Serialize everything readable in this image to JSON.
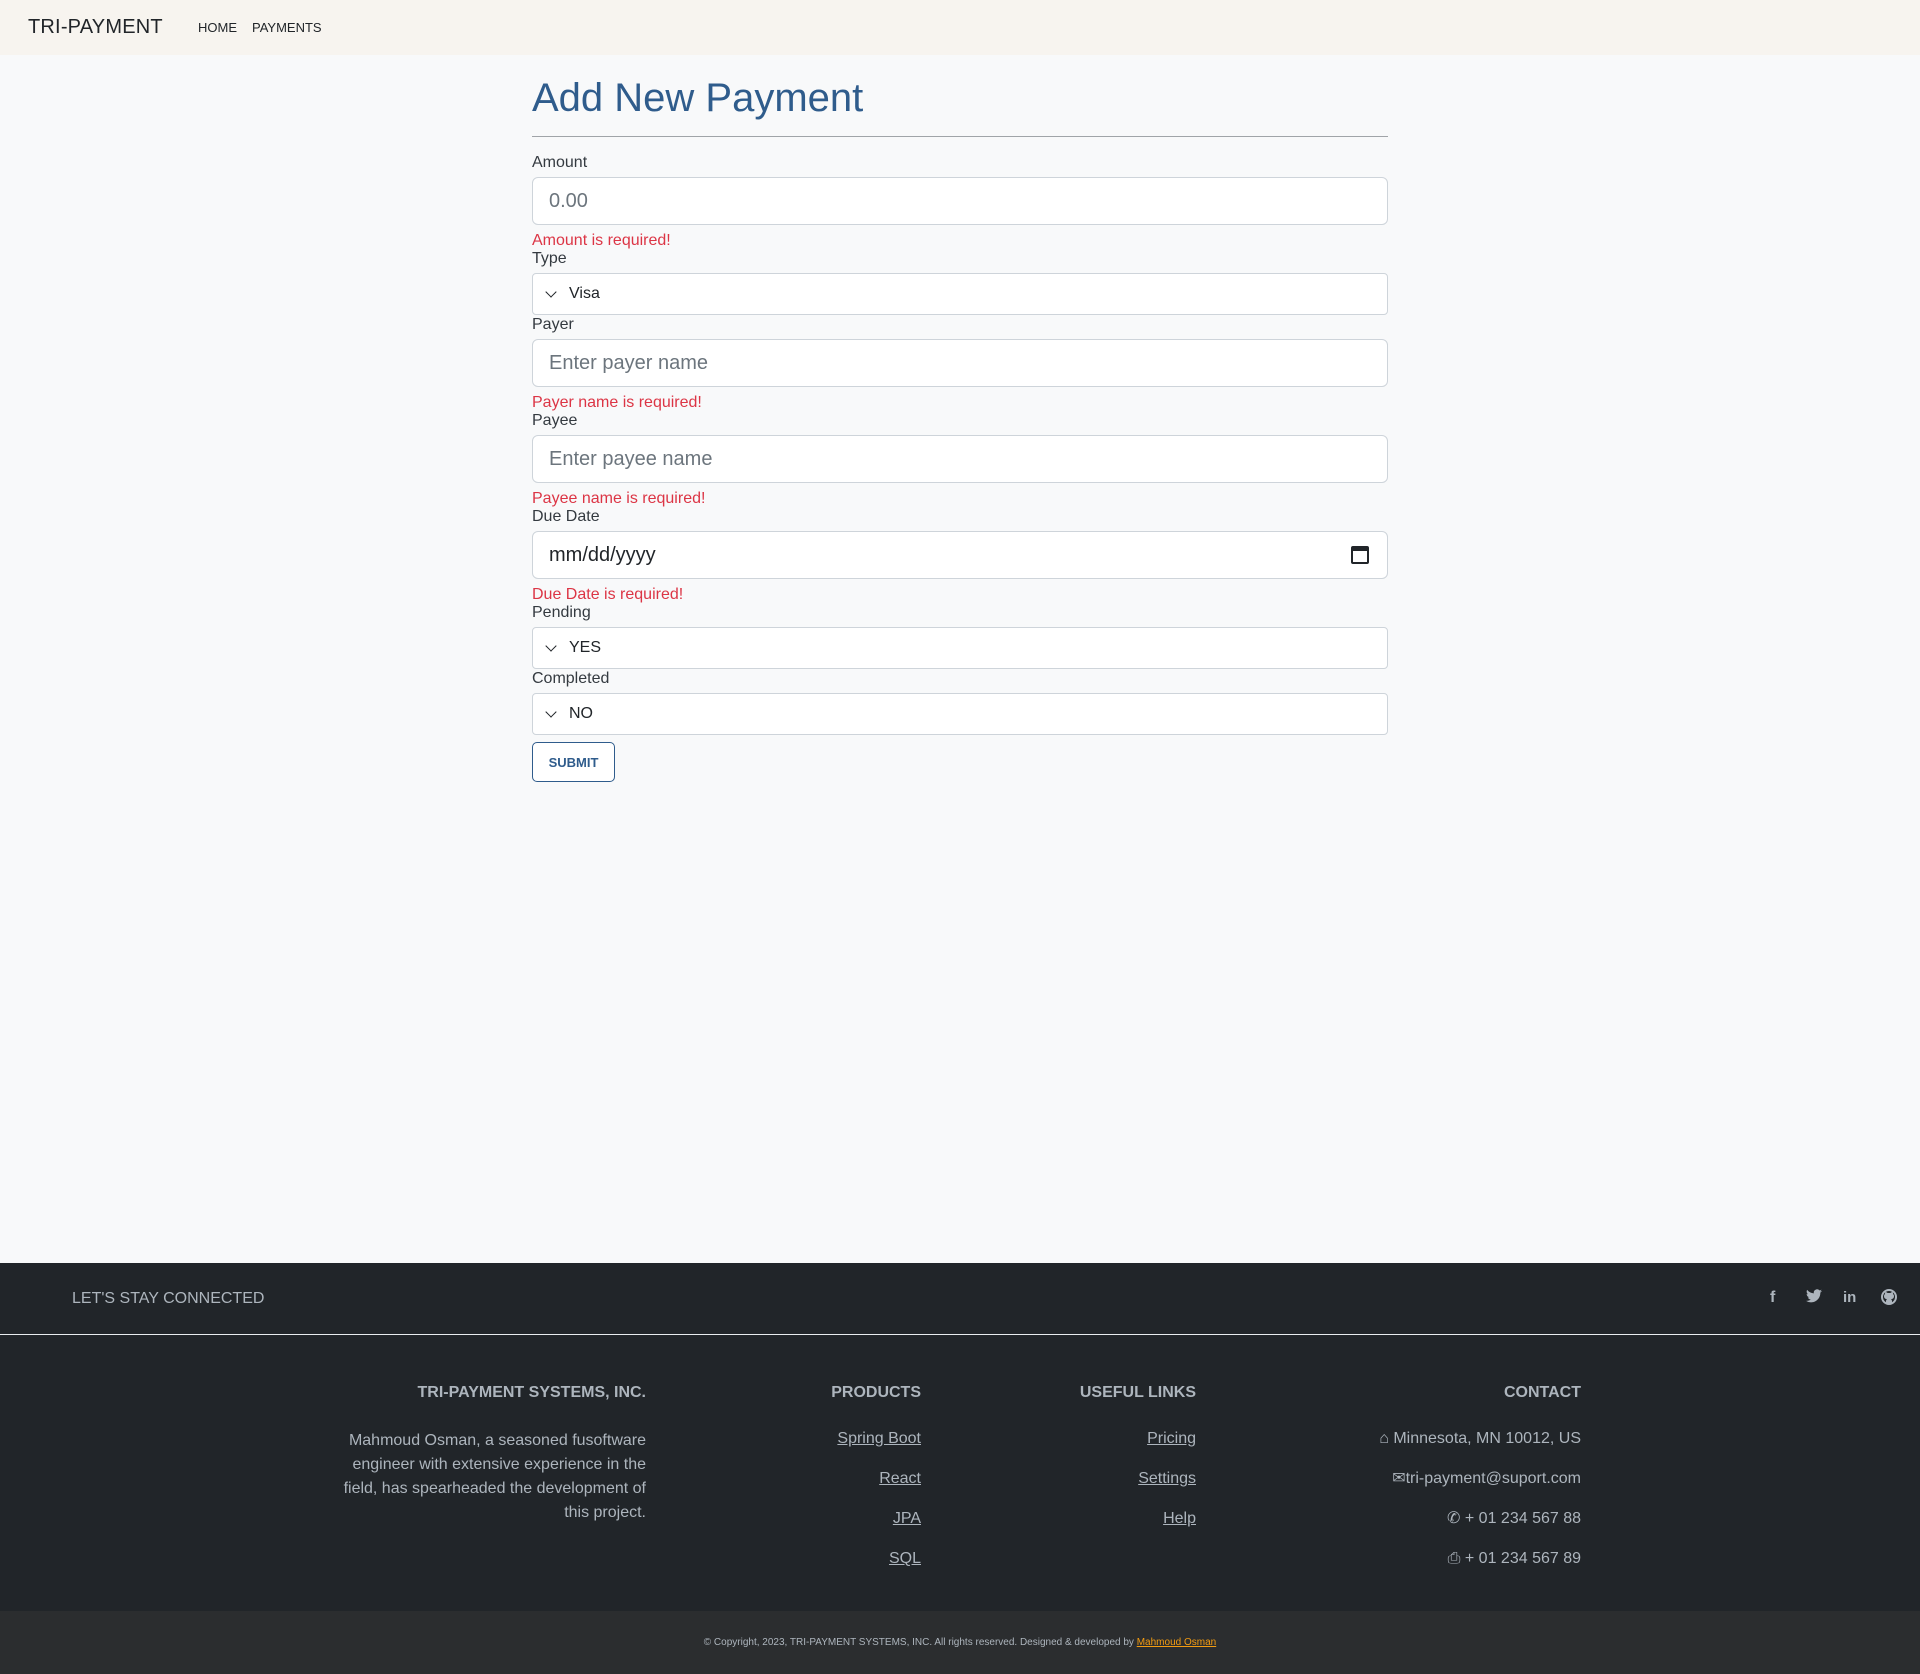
{
  "navbar": {
    "brand": "TRI-PAYMENT",
    "links": [
      "HOME",
      "PAYMENTS"
    ]
  },
  "form": {
    "title": "Add New Payment",
    "amount": {
      "label": "Amount",
      "placeholder": "0.00",
      "error": "Amount is required!"
    },
    "type": {
      "label": "Type",
      "value": "Visa"
    },
    "payer": {
      "label": "Payer",
      "placeholder": "Enter payer name",
      "error": "Payer name is required!"
    },
    "payee": {
      "label": "Payee",
      "placeholder": "Enter payee name",
      "error": "Payee name is required!"
    },
    "due_date": {
      "label": "Due Date",
      "placeholder": "mm/dd/yyyy",
      "error": "Due Date is required!"
    },
    "pending": {
      "label": "Pending",
      "value": "YES"
    },
    "completed": {
      "label": "Completed",
      "value": "NO"
    },
    "submit_label": "SUBMIT"
  },
  "footer": {
    "social_title": "LET'S STAY CONNECTED",
    "social_icons": [
      "facebook-icon",
      "twitter-icon",
      "linkedin-icon",
      "github-icon"
    ],
    "company": {
      "title": "TRI-PAYMENT SYSTEMS, INC.",
      "text": "Mahmoud Osman, a seasoned fusoftware engineer with extensive experience in the field, has spearheaded the development of this project."
    },
    "products": {
      "title": "PRODUCTS",
      "items": [
        "Spring Boot",
        "React",
        "JPA",
        "SQL"
      ]
    },
    "useful_links": {
      "title": "USEFUL LINKS",
      "items": [
        "Pricing",
        "Settings",
        "Help"
      ]
    },
    "contact": {
      "title": "CONTACT",
      "address": "Minnesota, MN 10012, US",
      "email": "tri-payment@suport.com",
      "phone": "+ 01 234 567 88",
      "fax": "+ 01 234 567 89"
    },
    "copyright": "© Copyright, 2023, TRI-PAYMENT SYSTEMS, INC. All rights reserved.   Designed & developed by",
    "developer": "Mahmoud Osman"
  },
  "colors": {
    "accent": "#2f5c8c",
    "error": "#dc3545",
    "footer_bg": "#212529",
    "navbar_bg": "#f7f4ef"
  }
}
